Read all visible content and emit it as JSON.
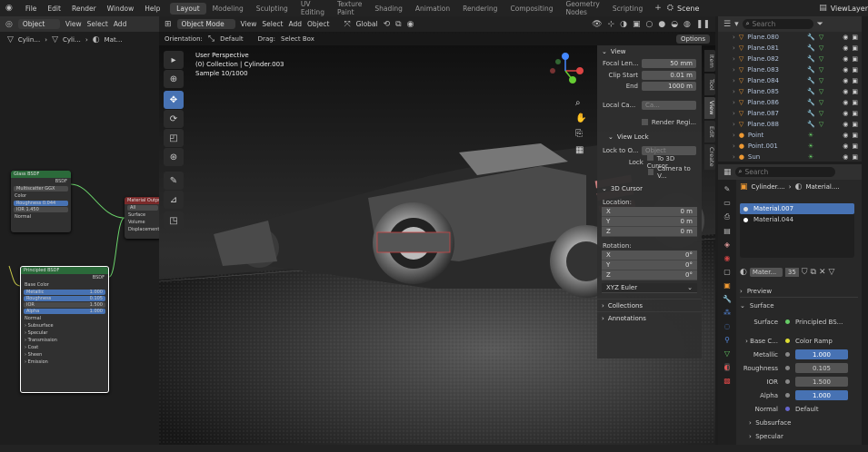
{
  "menubar": {
    "items": [
      "File",
      "Edit",
      "Render",
      "Window",
      "Help"
    ],
    "tabs": [
      "Layout",
      "Modeling",
      "Sculpting",
      "UV Editing",
      "Texture Paint",
      "Shading",
      "Animation",
      "Rendering",
      "Compositing",
      "Geometry Nodes",
      "Scripting"
    ],
    "scene": "Scene",
    "view_layer": "ViewLayer"
  },
  "node_editor": {
    "header_mode": "Object",
    "view": "View",
    "select": "Select",
    "add": "Add",
    "breadcrumb": [
      "Cylin…",
      "Cyli…",
      "Mat…"
    ]
  },
  "nodes": {
    "glass": {
      "title": "Glass BSDF",
      "out": "BSDF",
      "dist": "Multiscatter GGX",
      "rows": [
        "Color",
        "Roughness 0.044",
        "IOR 1.450",
        "Normal"
      ]
    },
    "matout": {
      "title": "Material Output",
      "all": "All",
      "rows": [
        "Surface",
        "Volume",
        "Displacement"
      ]
    },
    "principled": {
      "title": "Principled BSDF",
      "out": "BSDF",
      "rows": [
        "Base Color"
      ],
      "fields": [
        [
          "Metallic",
          "1.000"
        ],
        [
          "Roughness",
          "0.105"
        ],
        [
          "IOR",
          "1.500"
        ],
        [
          "Alpha",
          "1.000"
        ]
      ],
      "normal": "Normal",
      "subs": [
        "Subsurface",
        "Specular",
        "Transmission",
        "Coat",
        "Sheen",
        "Emission"
      ]
    }
  },
  "viewport": {
    "mode": "Object Mode",
    "menus": [
      "View",
      "Select",
      "Add",
      "Object"
    ],
    "transform": "Global",
    "orientation_label": "Orientation:",
    "orientation": "Default",
    "drag_label": "Drag:",
    "drag": "Select Box",
    "options": "Options",
    "overlay": [
      "User Perspective",
      "(0) Collection | Cylinder.003",
      "Sample 10/1000"
    ]
  },
  "npanel": {
    "view_title": "View",
    "focal_label": "Focal Len...",
    "focal": "50 mm",
    "clip_start_label": "Clip Start",
    "clip_start": "0.01 m",
    "end_label": "End",
    "end": "1000 m",
    "local_cam": "Local Ca...",
    "cam_field": "Ca...",
    "render_region": "Render Regi...",
    "viewlock": "View Lock",
    "lock_to": "Lock to O...",
    "object_ph": "Object",
    "lock": "Lock",
    "to_cursor": "To 3D Cursor",
    "cam_to_view": "Camera to V...",
    "cursor_title": "3D Cursor",
    "location": "Location:",
    "rotation": "Rotation:",
    "loc": [
      [
        "X",
        "0 m"
      ],
      [
        "Y",
        "0 m"
      ],
      [
        "Z",
        "0 m"
      ]
    ],
    "rot": [
      [
        "X",
        "0°"
      ],
      [
        "Y",
        "0°"
      ],
      [
        "Z",
        "0°"
      ]
    ],
    "euler": "XYZ Euler",
    "collections": "Collections",
    "annotations": "Annotations"
  },
  "side_tabs": [
    "Item",
    "Tool",
    "View",
    "Edit",
    "Create"
  ],
  "outliner": {
    "search_ph": "Search",
    "items": [
      "Plane.080",
      "Plane.081",
      "Plane.082",
      "Plane.083",
      "Plane.084",
      "Plane.085",
      "Plane.086",
      "Plane.087",
      "Plane.088",
      "Point",
      "Point.001",
      "Sun"
    ]
  },
  "properties": {
    "search_ph": "Search",
    "breadcrumb1": "Cylinder....",
    "breadcrumb2": "Material....",
    "slots": [
      "Material.007",
      "Material.044"
    ],
    "mat_name": "Mater...",
    "users": "35",
    "preview": "Preview",
    "surface_header": "Surface",
    "surface_label": "Surface",
    "surface_val": "Principled BS...",
    "base_color": "Base C...",
    "color_ramp": "Color Ramp",
    "rows": [
      [
        "Metallic",
        "1.000"
      ],
      [
        "Roughness",
        "0.105"
      ],
      [
        "IOR",
        "1.500"
      ],
      [
        "Alpha",
        "1.000"
      ]
    ],
    "normal_label": "Normal",
    "normal_val": "Default",
    "subsurface": "Subsurface",
    "specular": "Specular"
  }
}
